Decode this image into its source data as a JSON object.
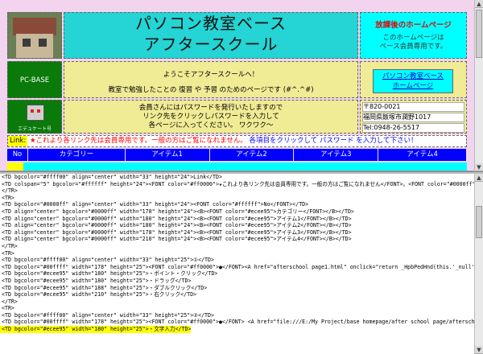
{
  "banner": {
    "line1": "パソコン教室ベース",
    "line2": "アフタースクール"
  },
  "side_top": {
    "heading": "放課後のホームページ",
    "body1": "このホームページは",
    "body2": "ベース会員専用です。"
  },
  "pcbase": "PC-BASE",
  "welcome": {
    "line1": "ようこそアフタースクールへ！",
    "line2": "教室で勉強したことの 復習 や 予習 のためのページです (#^.^#)"
  },
  "robot_caption": "エデュケート号",
  "members": {
    "line1": "会員さんにはパスワードを発行いたしますので",
    "line2": "リンク先をクリックしパスワードを入力して",
    "line3": "各ページに入ってください。 ワクワク～"
  },
  "hp_link": {
    "line1": "パソコン教室ベース",
    "line2": "ホームページ"
  },
  "address": [
    "〒820-0021",
    "福岡県飯塚市潤野1017",
    "Tel:0948-26-5517"
  ],
  "linkbar": {
    "label": "Link:",
    "red_text": "★これより各リンク先は会員専用です。一般の方はご覧になれません。",
    "blue_text": "各項目をクリックして パスワード を入力して下さい！"
  },
  "nav": [
    "No",
    "カテゴリー",
    "アイテム1",
    "アイテム2",
    "アイテム3",
    "アイテム4"
  ],
  "code_lines": [
    "<TD bgcolor=\"#ffff00\" align=\"center\" width=\"33\" height=\"24\">Link</TD>",
    "<TD colspan=\"5\" bgcolor=\"#ffffff\" height=\"24\"><FONT color=\"#ff0000\">★これより各リンク先は会員専用です。一般の方はご覧になれません</FONT>。<FONT color=\"#0000ff\">各項目をクリ",
    "</TR>",
    "<TR>",
    "<TD bgcolor=\"#0000ff\" align=\"center\" width=\"33\" height=\"24\"><FONT color=\"#ffffff\">No</FONT></TD>",
    "<TD align=\"center\" bgcolor=\"#0000ff\" width=\"178\" height=\"24\"><B><FONT color=\"#ecee95\">カテゴリー</FONT></B></TD>",
    "<TD align=\"center\" bgcolor=\"#0000ff\" width=\"180\" height=\"24\"><B><FONT color=\"#ecee95\">アイテム1</FONT></B></TD>",
    "<TD align=\"center\" bgcolor=\"#0000ff\" width=\"180\" height=\"24\"><B><FONT color=\"#ecee95\">アイテム2</FONT></B></TD>",
    "<TD align=\"center\" bgcolor=\"#0000ff\" width=\"178\" height=\"24\"><B><FONT color=\"#ecee95\">アイテム3</FONT></B></TD>",
    "<TD align=\"center\" bgcolor=\"#0000ff\" width=\"210\" height=\"24\"><B><FONT color=\"#ecee95\">アイテム4</FONT></B></TD>",
    "</TR>",
    "<TR>",
    "<TD bgcolor=\"#ffff00\" align=\"center\" width=\"33\" height=\"25\">①</TD>",
    "<TD bgcolor=\"#00ffff\" width=\"178\" height=\"25\"><FONT color=\"#ff0000\">●</FONT><A href=\"afterschool page1.html\" onclick=\"return _HpbPedHnd(this.'_null'[.$]hR9oa0'[DG#'.YbED",
    "<TD bgcolor=\"#ecee95\" width=\"180\" height=\"25\">・ポイント・クリック</TD>",
    "<TD bgcolor=\"#ecee95\" width=\"180\" height=\"25\">・ドラッグ</TD>",
    "<TD bgcolor=\"#ecee95\" width=\"188\" height=\"25\">・ダブルクリック</TD>",
    "<TD bgcolor=\"#ecee95\" width=\"210\" height=\"25\">・右クリック</TD>",
    "</TR>",
    "<TR>",
    "<TD bgcolor=\"#ffff00\" align=\"center\" width=\"33\" height=\"25\">②</TD>",
    "<TD bgcolor=\"#00ffff\" width=\"178\" height=\"25\"><FONT color=\"#ff0000\">●</FONT> <A href=\"file:///E:/My Project/base homepage/after school page/afterschool page1.html\" onclick",
    "<TD bgcolor=\"#ecee95\" width=\"180\" height=\"25\">・文字入力</TD>"
  ]
}
